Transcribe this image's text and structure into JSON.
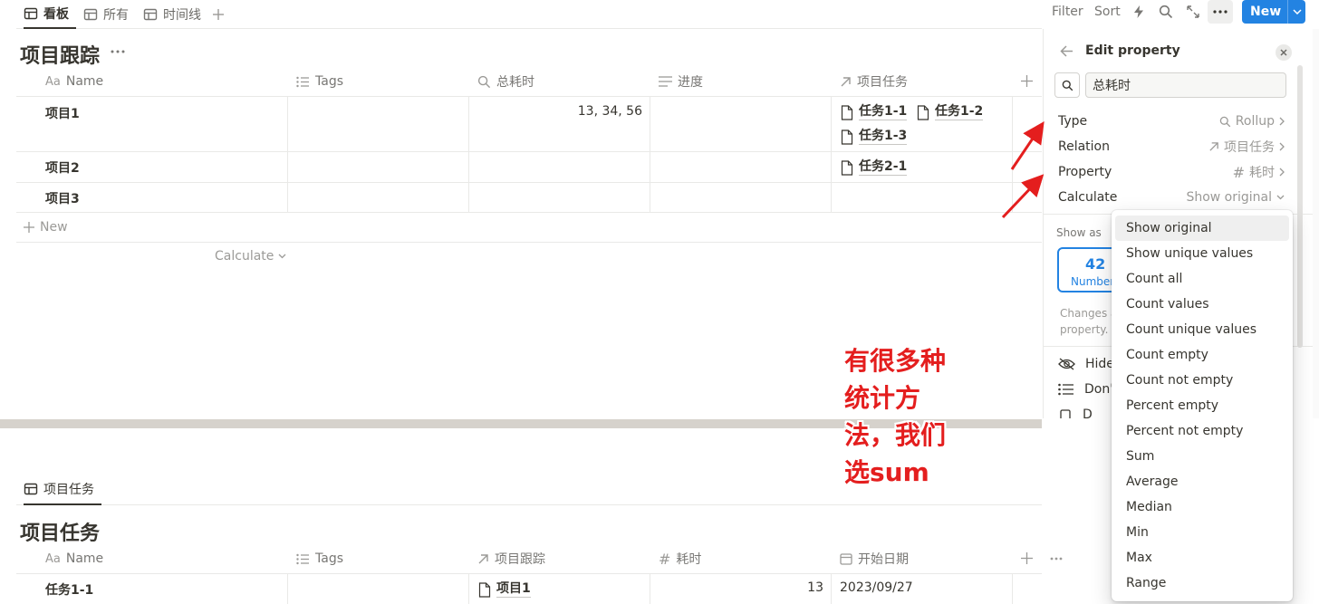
{
  "view_tabs": [
    {
      "label": "看板",
      "active": true
    },
    {
      "label": "所有",
      "active": false
    },
    {
      "label": "时间线",
      "active": false
    }
  ],
  "toolbar": {
    "filter": "Filter",
    "sort": "Sort",
    "new": "New"
  },
  "db1": {
    "title": "项目跟踪",
    "columns": [
      "Name",
      "Tags",
      "总耗时",
      "进度",
      "项目任务"
    ],
    "name_prefix": "Aa",
    "rows": [
      {
        "name": "项目1",
        "total": "13, 34, 56",
        "tasks": [
          "任务1-1",
          "任务1-2",
          "任务1-3"
        ]
      },
      {
        "name": "项目2",
        "total": "",
        "tasks": [
          "任务2-1"
        ]
      },
      {
        "name": "项目3",
        "total": "",
        "tasks": []
      }
    ],
    "new_label": "New",
    "calculate_label": "Calculate"
  },
  "panel": {
    "title": "Edit property",
    "name_value": "总耗时",
    "rows": {
      "type": {
        "label": "Type",
        "value": "Rollup"
      },
      "relation": {
        "label": "Relation",
        "value": "项目任务"
      },
      "property": {
        "label": "Property",
        "value": "耗时"
      },
      "calculate": {
        "label": "Calculate",
        "value": "Show original"
      }
    },
    "show_as": "Show as",
    "card_number": "42",
    "card_label": "Number",
    "changes_text_1": "Changes a",
    "changes_text_2": "property.",
    "hide_label": "Hide",
    "dont_label": "Don'",
    "last_label": "D"
  },
  "dropdown": {
    "selected": "Show original",
    "options": [
      "Show original",
      "Show unique values",
      "Count all",
      "Count values",
      "Count unique values",
      "Count empty",
      "Count not empty",
      "Percent empty",
      "Percent not empty",
      "Sum",
      "Average",
      "Median",
      "Min",
      "Max",
      "Range"
    ]
  },
  "annotation": {
    "lines": [
      "有很多种",
      "统计方",
      "法，我们",
      "选sum"
    ]
  },
  "colors": {
    "accent": "#2383e2",
    "annotation": "#e41e1e",
    "text": "#37352f",
    "muted": "#787774"
  },
  "db2": {
    "tab_label": "项目任务",
    "title": "项目任务",
    "name_prefix": "Aa",
    "columns": [
      "Name",
      "Tags",
      "项目跟踪",
      "耗时",
      "开始日期"
    ],
    "rows": [
      {
        "name": "任务1-1",
        "project": "项目1",
        "time": "13",
        "date": "2023/09/27"
      }
    ]
  }
}
